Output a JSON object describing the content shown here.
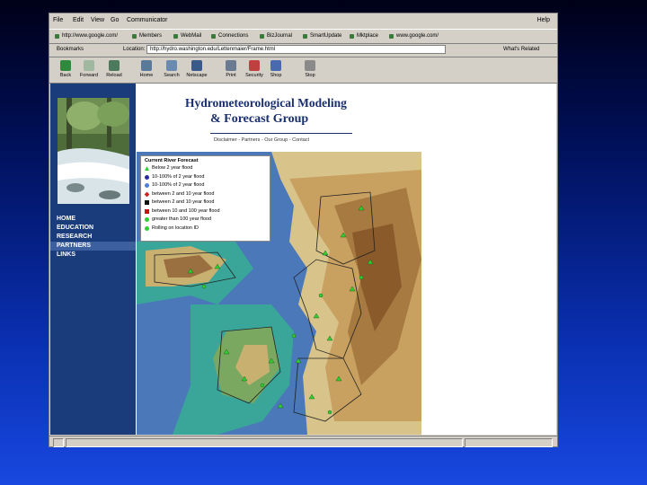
{
  "menu": {
    "items": [
      "File",
      "Edit",
      "View",
      "Go",
      "Communicator"
    ],
    "help": "Help"
  },
  "links_bar": [
    "http://www.google.com/",
    "Members",
    "WebMail",
    "Connections",
    "BizJournal",
    "SmartUpdate",
    "Mktplace",
    "www.google.com/"
  ],
  "address": {
    "directory": "Bookmarks",
    "label": "Location:",
    "url": "http://hydro.washington.edu/Lettenmaier/Frame.html",
    "related": "What's Related"
  },
  "toolbar": {
    "buttons": [
      {
        "label": "Back",
        "icon": "back-arrow-icon"
      },
      {
        "label": "Forward",
        "icon": "forward-arrow-icon"
      },
      {
        "label": "Reload",
        "icon": "reload-icon"
      },
      {
        "label": "Home",
        "icon": "home-icon"
      },
      {
        "label": "Search",
        "icon": "search-icon"
      },
      {
        "label": "Netscape",
        "icon": "netscape-icon"
      },
      {
        "label": "Print",
        "icon": "print-icon"
      },
      {
        "label": "Security",
        "icon": "security-lock-icon"
      },
      {
        "label": "Shop",
        "icon": "shop-icon"
      },
      {
        "label": "Stop",
        "icon": "stop-icon"
      }
    ]
  },
  "page": {
    "title_line1": "Hydrometeorological Modeling",
    "title_line2": "& Forecast Group",
    "sublinks": "Disclaimer - Partners - Our Group - Contact",
    "nav": [
      "HOME",
      "EDUCATION",
      "RESEARCH",
      "PARTNERS",
      "LINKS"
    ],
    "nav_selected": "PARTNERS"
  },
  "legend": {
    "title": "Current River Forecast",
    "items": [
      {
        "label": "Below 2 year flood",
        "color": "#33cc33",
        "shape": "triangle"
      },
      {
        "label": "10-100% of 2 year flood",
        "color": "#2a2aa0",
        "shape": "circle"
      },
      {
        "label": "10-100% of 2 year flood",
        "color": "#4f7fd8",
        "shape": "circle"
      },
      {
        "label": "between 2 and 10 year flood",
        "color": "#cc2222",
        "shape": "diamond"
      },
      {
        "label": "between 2 and 10 year flood",
        "color": "#111111",
        "shape": "square"
      },
      {
        "label": "between 10 and 100 year flood",
        "color": "#cc1111",
        "shape": "square"
      },
      {
        "label": "greater than 100 year flood",
        "color": "#33cc33",
        "shape": "circle"
      },
      {
        "label": "Rolling on location ID",
        "color": "#33cc33",
        "shape": "circle"
      }
    ]
  },
  "colors": {
    "sidebar": "#1a3c7a",
    "title": "#1a2f6e",
    "water": "#4a78b8",
    "lowland": "#3aa69a",
    "mountain": "#c8a060"
  }
}
